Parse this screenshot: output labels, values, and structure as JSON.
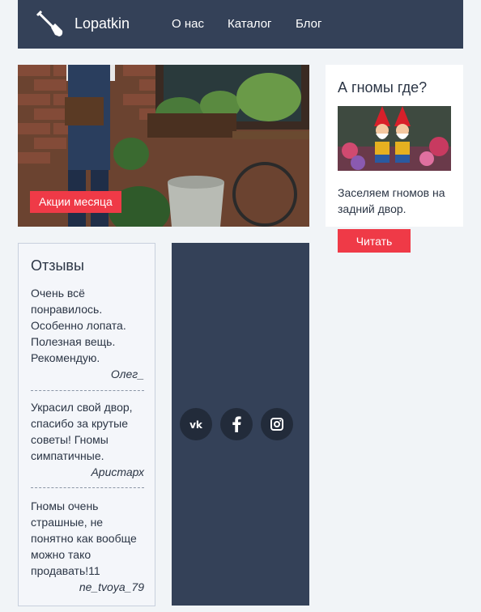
{
  "header": {
    "logo_text": "Lopatkin",
    "nav": [
      "О нас",
      "Каталог",
      "Блог"
    ]
  },
  "hero": {
    "button_label": "Акции месяца"
  },
  "promo": {
    "title": "А гномы где?",
    "text": "Заселяем гномов на задний двор.",
    "button_label": "Читать"
  },
  "reviews": {
    "title": "Отзывы",
    "items": [
      {
        "text": "Очень всё понравилось. Особенно лопата. Полезная вещь. Рекомендую.",
        "author": "Олег_"
      },
      {
        "text": "Украсил свой двор, спасибо за крутые советы! Гномы симпатичные.",
        "author": "Аристарх"
      },
      {
        "text": "Гномы очень страшные, не понятно как вообще можно тако продавать!11",
        "author": "ne_tvoya_79"
      }
    ]
  },
  "social": {
    "icons": [
      "vk-icon",
      "facebook-icon",
      "instagram-icon"
    ]
  },
  "colors": {
    "header_bg": "#344158",
    "accent": "#ef3a47",
    "page_bg": "#f1f4f7"
  }
}
